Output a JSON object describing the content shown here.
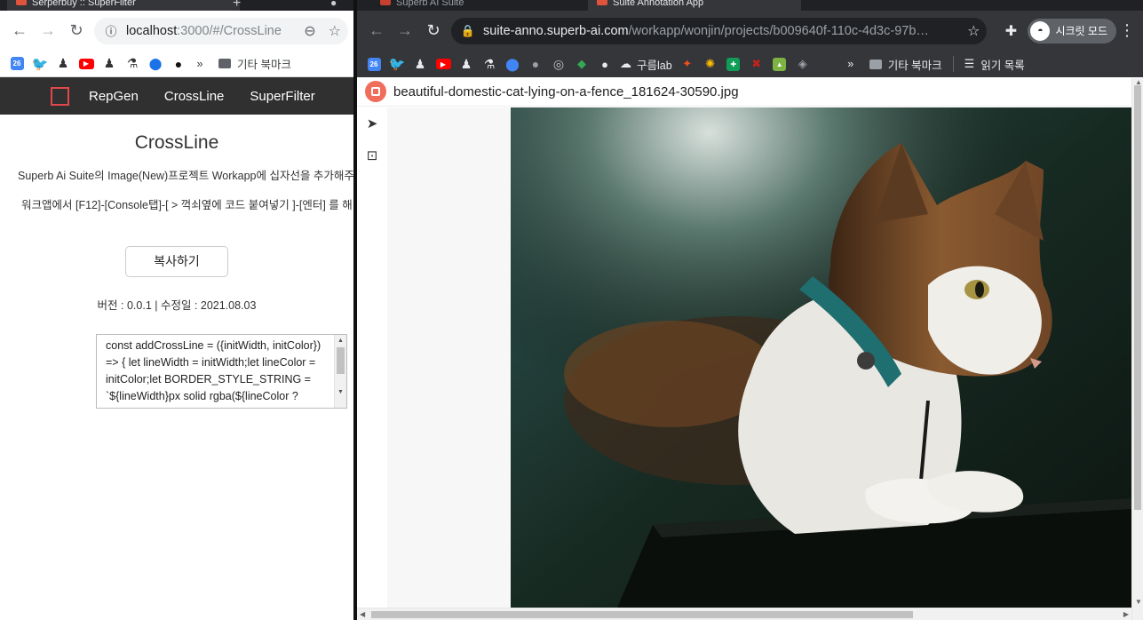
{
  "left_window": {
    "tab_title": "Serperbuy :: SuperFilter",
    "url_host": "localhost",
    "url_rest": ":3000/#/CrossLine",
    "bookmark_folder": "기타 북마크",
    "bookmark_more": "»",
    "calendar_badge": "26",
    "app_nav": {
      "items": [
        "RepGen",
        "CrossLine",
        "SuperFilter"
      ]
    },
    "page": {
      "title": "CrossLine",
      "description": "Superb Ai Suite의 Image(New)프로젝트 Workapp에 십자선을 추가해주",
      "instructions": "워크앱에서 [F12]-[Console탭]-[ > 꺽쇠옆에 코드 붙여넣기 ]-[엔터] 를 해",
      "copy_button": "복사하기",
      "meta": "버전 : 0.0.1 | 수정일 : 2021.08.03",
      "code": "const addCrossLine = ({initWidth, initColor}) => { let lineWidth = initWidth;let lineColor  = initColor;let BORDER_STYLE_STRING = `${lineWidth}px solid rgba(${lineColor ?"
    }
  },
  "right_window": {
    "tabs": [
      "Superb AI Suite",
      "Suite Annotation App"
    ],
    "url_host": "suite-anno.superb-ai.com",
    "url_rest": "/workapp/wonjin/projects/b009640f-110c-4d3c-97b…",
    "profile_label": "시크릿 모드",
    "bookmarks": {
      "calendar_badge": "26",
      "goorm": "구름lab",
      "more": "»",
      "folder": "기타 북마크",
      "reading_list": "읽기 목록"
    },
    "anno": {
      "filename": "beautiful-domestic-cat-lying-on-a-fence_181624-30590.jpg"
    }
  },
  "colors": {
    "accent_red": "#e2484b",
    "superb_logo": "#f06c5b",
    "dark_chrome": "#35363a",
    "app_nav_bg": "#303030"
  }
}
